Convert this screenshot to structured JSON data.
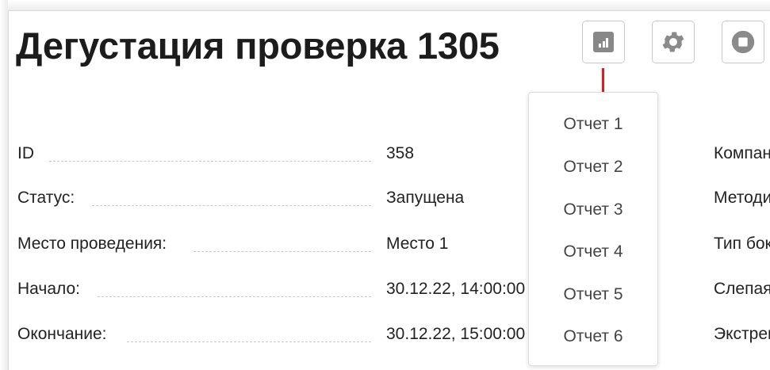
{
  "header": {
    "title": "Дегустация проверка 1305"
  },
  "toolbar": {
    "report_icon": "bar-chart-icon",
    "settings_icon": "gear-icon",
    "stop_icon": "stop-circle-icon"
  },
  "dropdown": {
    "items": [
      "Отчет 1",
      "Отчет 2",
      "Отчет 3",
      "Отчет 4",
      "Отчет 5",
      "Отчет 6"
    ]
  },
  "details": {
    "rows": [
      {
        "label": "ID",
        "value": "358"
      },
      {
        "label": "Статус:",
        "value": "Запущена"
      },
      {
        "label": "Место проведения:",
        "value": "Место 1"
      },
      {
        "label": "Начало:",
        "value": "30.12.22, 14:00:00"
      },
      {
        "label": "Окончание:",
        "value": "30.12.22, 15:00:00"
      }
    ],
    "right_labels": [
      "Компания",
      "Методика",
      "Тип бокса",
      "Слепая",
      "Экстренная"
    ]
  },
  "colors": {
    "arrow": "#e31b1b",
    "icon_gray": "#888888"
  }
}
